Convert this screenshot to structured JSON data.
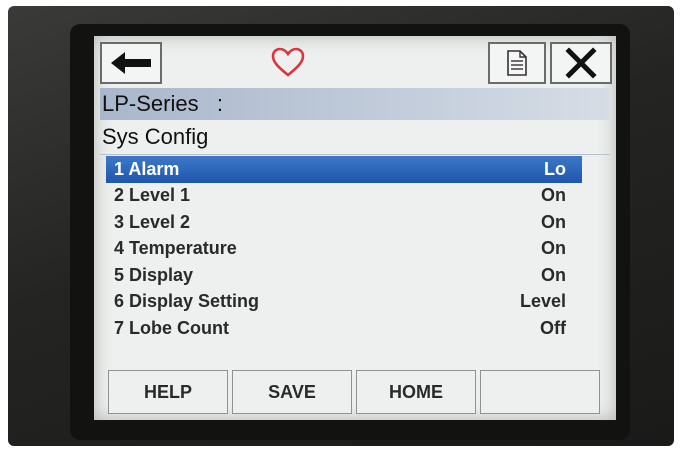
{
  "device": {
    "brand_color": "#1f57ab",
    "accent_heart_color": "#d9363e"
  },
  "toolbar": {
    "back_icon": "arrow-left-icon",
    "status_icon": "heart-icon",
    "doc_icon": "document-icon",
    "close_icon": "close-icon"
  },
  "header": {
    "title": "LP-Series   :",
    "subtitle": "Sys Config"
  },
  "menu": {
    "items": [
      {
        "label": "1 Alarm",
        "value": "Lo",
        "selected": true
      },
      {
        "label": "2 Level 1",
        "value": "On",
        "selected": false
      },
      {
        "label": "3 Level 2",
        "value": "On",
        "selected": false
      },
      {
        "label": "4 Temperature",
        "value": "On",
        "selected": false
      },
      {
        "label": "5 Display",
        "value": "On",
        "selected": false
      },
      {
        "label": "6 Display Setting",
        "value": "Level",
        "selected": false
      },
      {
        "label": "7 Lobe Count",
        "value": "Off",
        "selected": false
      }
    ]
  },
  "softkeys": {
    "help": "HELP",
    "save": "SAVE",
    "home": "HOME",
    "blank": ""
  }
}
